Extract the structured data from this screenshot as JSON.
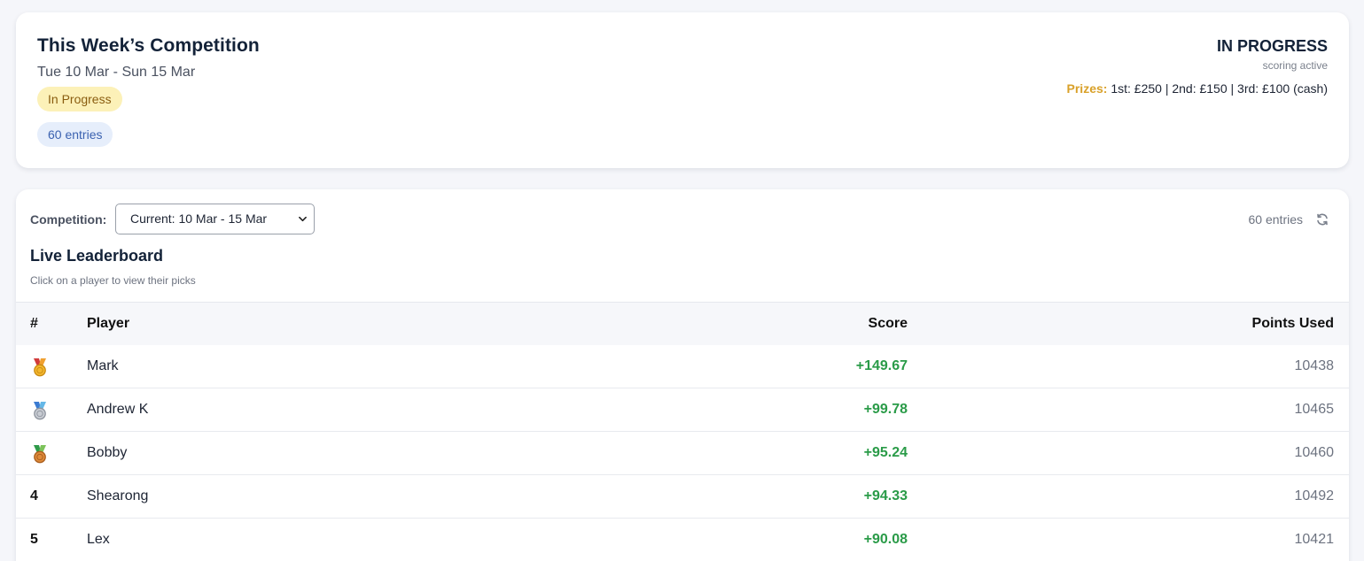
{
  "competition": {
    "title": "This Week’s Competition",
    "dates": "Tue 10 Mar - Sun 15 Mar",
    "status_pill": "In Progress",
    "entries_pill": "60 entries",
    "status_heading": "IN PROGRESS",
    "status_sub": "scoring active",
    "prizes_label": "Prizes:",
    "prizes_text": "1st: £250 | 2nd: £150 | 3rd: £100 (cash)"
  },
  "leaderboard": {
    "selector_label": "Competition:",
    "selector_value": "Current: 10 Mar - 15 Mar",
    "entries_count": "60 entries",
    "title": "Live Leaderboard",
    "subtitle": "Click on a player to view their picks",
    "headers": {
      "rank": "#",
      "player": "Player",
      "score": "Score",
      "points": "Points Used"
    },
    "rows": [
      {
        "rank": "1",
        "medal": "gold",
        "player": "Mark",
        "score": "+149.67",
        "points": "10438"
      },
      {
        "rank": "2",
        "medal": "silver",
        "player": "Andrew K",
        "score": "+99.78",
        "points": "10465"
      },
      {
        "rank": "3",
        "medal": "bronze",
        "player": "Bobby",
        "score": "+95.24",
        "points": "10460"
      },
      {
        "rank": "4",
        "medal": "",
        "player": "Shearong",
        "score": "+94.33",
        "points": "10492"
      },
      {
        "rank": "5",
        "medal": "",
        "player": "Lex",
        "score": "+90.08",
        "points": "10421"
      }
    ]
  },
  "colors": {
    "score_positive": "#2a9b48",
    "prize_label": "#d9a12a",
    "status_pill_bg": "#fcf1b8",
    "entries_pill_bg": "#e6eefb"
  }
}
